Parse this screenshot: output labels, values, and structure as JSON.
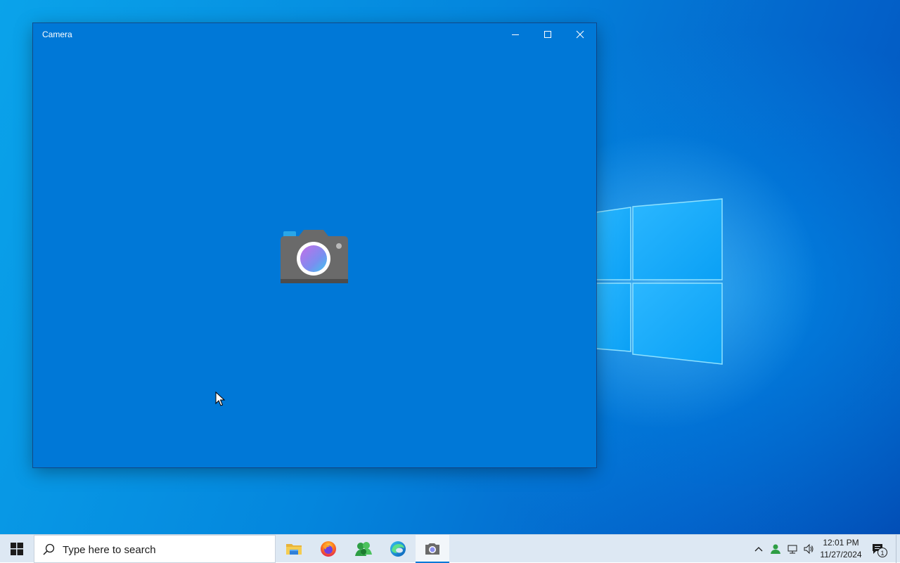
{
  "window": {
    "title": "Camera",
    "controls": [
      "minimize",
      "maximize",
      "close"
    ],
    "background": "#0078d7",
    "content_icon": "camera-icon"
  },
  "taskbar": {
    "search_placeholder": "Type here to search",
    "apps": [
      {
        "name": "File Explorer",
        "icon": "folder-icon",
        "active": false
      },
      {
        "name": "Firefox",
        "icon": "firefox-icon",
        "active": false
      },
      {
        "name": "People",
        "icon": "people-icon",
        "active": false
      },
      {
        "name": "Microsoft Edge",
        "icon": "edge-icon",
        "active": false
      },
      {
        "name": "Camera",
        "icon": "camera-icon",
        "active": true
      }
    ],
    "tray": {
      "icons": [
        "chevron-up-icon",
        "people-icon",
        "network-icon",
        "volume-icon"
      ],
      "time": "12:01 PM",
      "date": "11/27/2024",
      "notification_count": "1"
    }
  },
  "colors": {
    "accent": "#0078d7",
    "taskbar": "#dde8f3"
  }
}
